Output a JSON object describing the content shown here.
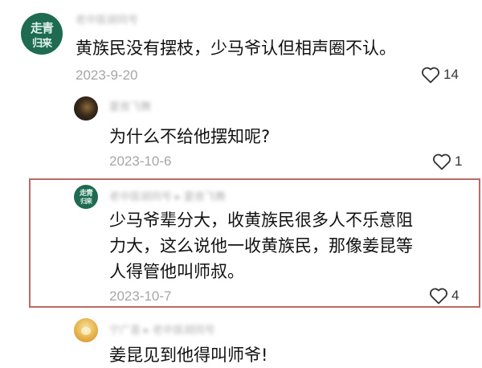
{
  "comments": [
    {
      "avatar_text_line1": "走青",
      "avatar_text_line2": "归来",
      "username": "老中医胡同号",
      "text_lines": [
        "黄族民没有摆枝，少马爷认但相声圈不认。"
      ],
      "date": "2023-9-20",
      "likes": "14"
    },
    {
      "username": "夏夜飞舞",
      "text_lines": [
        "为什么不给他摆知呢?"
      ],
      "date": "2023-10-6",
      "likes": "1"
    },
    {
      "avatar_text_line1": "走青",
      "avatar_text_line2": "归来",
      "username": "老中医胡同号 ▸ 夏夜飞舞",
      "text_lines": [
        "少马爷辈分大，收黄族民很多人不乐意阻",
        "力大，这么说他一收黄族民，那像姜昆等",
        "人得管他叫师叔。"
      ],
      "date": "2023-10-7",
      "likes": "4"
    },
    {
      "username": "宁广喜 ▸ 老中医胡同号",
      "text_lines": [
        "姜昆见到他得叫师爷!"
      ]
    }
  ],
  "colors": {
    "highlight_border": "#b86a66",
    "date_gray": "#a6a6a6",
    "text": "#111111"
  },
  "icons": {
    "like": "heart-outline-icon"
  }
}
